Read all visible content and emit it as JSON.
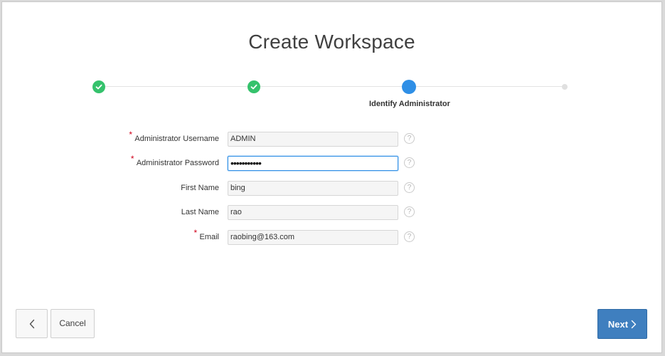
{
  "dialog": {
    "title": "Create Workspace"
  },
  "progress": {
    "steps": [
      {
        "state": "complete",
        "icon": "checkmark-icon"
      },
      {
        "state": "complete",
        "icon": "checkmark-icon"
      },
      {
        "state": "current",
        "label": "Identify Administrator"
      },
      {
        "state": "upcoming"
      }
    ],
    "colors": {
      "complete": "#35c26c",
      "current": "#2f8fe6",
      "upcoming": "#e0e0e0"
    }
  },
  "form": {
    "required_marker": "*",
    "help_glyph": "?",
    "fields": [
      {
        "label": "Administrator Username",
        "value": "ADMIN",
        "required": true
      },
      {
        "label": "Administrator Password",
        "value": "•••••••••••",
        "required": true,
        "focused": true
      },
      {
        "label": "First Name",
        "value": "bing",
        "required": false
      },
      {
        "label": "Last Name",
        "value": "rao",
        "required": false
      },
      {
        "label": "Email",
        "value": "raobing@163.com",
        "required": true
      }
    ]
  },
  "footer": {
    "back_icon": "chevron-left-icon",
    "cancel_label": "Cancel",
    "next_label": "Next",
    "next_icon": "chevron-right-icon",
    "primary_color": "#3f7fbf"
  }
}
